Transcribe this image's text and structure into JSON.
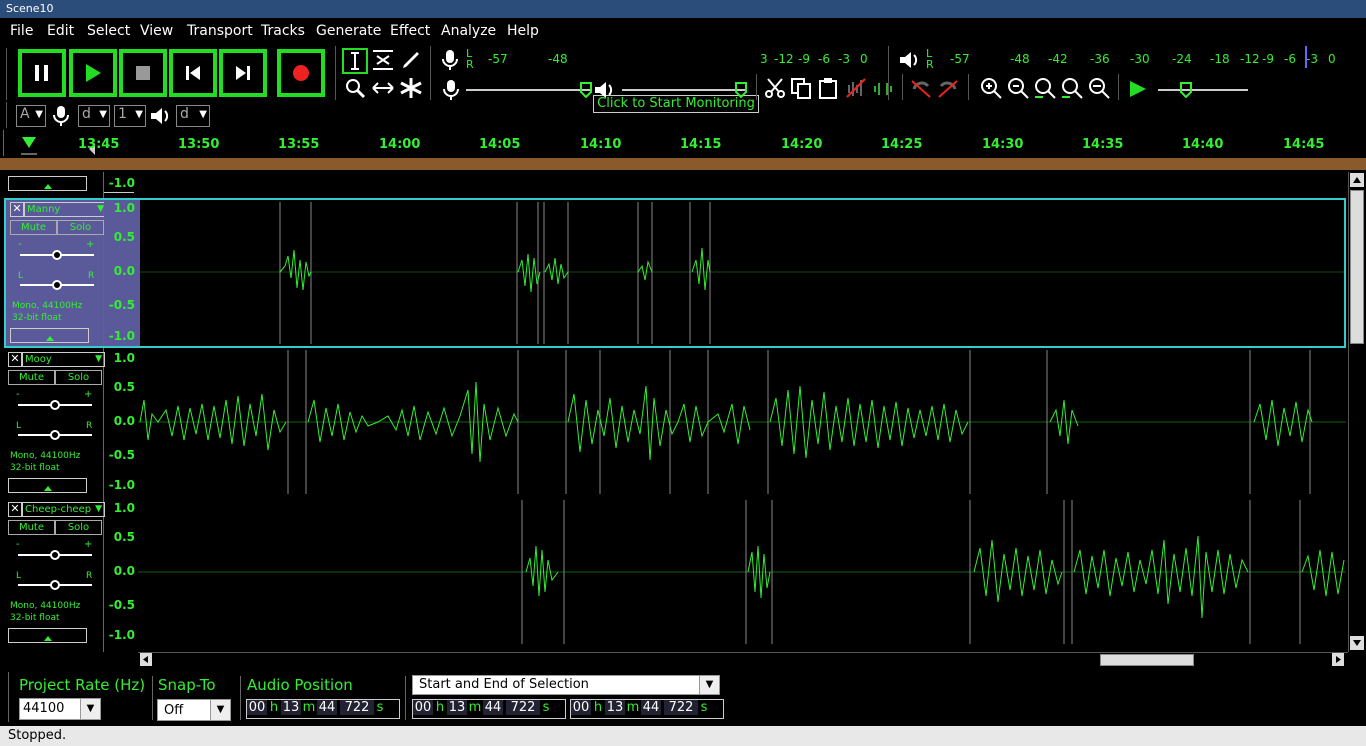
{
  "window": {
    "title": "Scene10"
  },
  "menu": [
    "File",
    "Edit",
    "Select",
    "View",
    "Transport",
    "Tracks",
    "Generate",
    "Effect",
    "Analyze",
    "Help"
  ],
  "meters": {
    "record_scale": [
      "-57",
      "-48",
      "3",
      "-12",
      "-9",
      "-6",
      "-3",
      "0"
    ],
    "play_scale": [
      "-57",
      "-48",
      "-42",
      "-36",
      "-30",
      "-24",
      "-18",
      "-12",
      "-9",
      "-6",
      "-3",
      "0"
    ],
    "monitor_label": "Click to Start Monitoring",
    "lr": [
      "L",
      "R"
    ]
  },
  "device": {
    "host": "A",
    "rec_device": "d",
    "channels": "1",
    "play_device": "d"
  },
  "ruler": {
    "ticks": [
      "13:45",
      "13:50",
      "13:55",
      "14:00",
      "14:05",
      "14:10",
      "14:15",
      "14:20",
      "14:25",
      "14:30",
      "14:35",
      "14:40",
      "14:45"
    ]
  },
  "tracks": [
    {
      "name": "Manny",
      "mute": "Mute",
      "solo": "Solo",
      "info1": "Mono, 44100Hz",
      "info2": "32-bit float",
      "scale": [
        "1.0",
        "0.5",
        "0.0",
        "-0.5",
        "-1.0"
      ]
    },
    {
      "name": "Mooy",
      "mute": "Mute",
      "solo": "Solo",
      "info1": "Mono, 44100Hz",
      "info2": "32-bit float",
      "scale": [
        "1.0",
        "0.5",
        "0.0",
        "-0.5",
        "-1.0"
      ]
    },
    {
      "name": "Cheep-cheep",
      "mute": "Mute",
      "solo": "Solo",
      "info1": "Mono, 44100Hz",
      "info2": "32-bit float",
      "scale": [
        "1.0",
        "0.5",
        "0.0",
        "-0.5",
        "-1.0"
      ]
    }
  ],
  "top_scale_value": "-1.0",
  "slider_labels": {
    "gain_minus": "-",
    "gain_plus": "+",
    "pan_l": "L",
    "pan_r": "R"
  },
  "bottom": {
    "project_rate_label": "Project Rate (Hz)",
    "project_rate_value": "44100",
    "snap_label": "Snap-To",
    "snap_value": "Off",
    "audio_position_label": "Audio Position",
    "selection_label": "Start and End of Selection",
    "time_digits": [
      "00",
      "h",
      "13",
      "m",
      "44",
      "722",
      "s"
    ]
  },
  "status": "Stopped.",
  "colors": {
    "accent": "#33ee33",
    "title_bg": "#2b4d79",
    "selected_track": "#5a5a9a",
    "brown": "#8a5a2a"
  }
}
